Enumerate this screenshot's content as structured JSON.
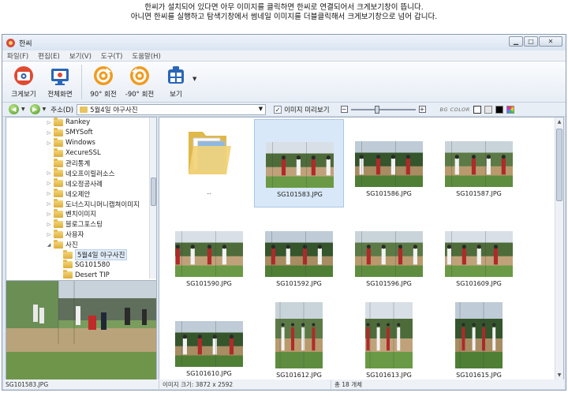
{
  "caption": {
    "line1": "한씨가 설치되어 있다면 아무 이미지를 클릭하면 한씨로 연결되어서 크게보기창이 뜹니다.",
    "line2": "아니면 한씨를 실행하고 탐색기창에서 썸네일 이미지를 더블클릭해서 크게보기창으로 넘어 갑니다."
  },
  "window": {
    "title": "한씨"
  },
  "menu": [
    "파일(F)",
    "편집(E)",
    "보기(V)",
    "도구(T)",
    "도움말(H)"
  ],
  "toolbar": {
    "buttons": [
      {
        "label": "크게보기",
        "icon": "large-view-icon"
      },
      {
        "label": "전체화면",
        "icon": "fullscreen-icon"
      },
      {
        "label": "90° 회전",
        "icon": "rotate-right-icon"
      },
      {
        "label": "-90° 회전",
        "icon": "rotate-left-icon"
      },
      {
        "label": "보기",
        "icon": "view-icon"
      }
    ]
  },
  "address": {
    "label": "주소(D)",
    "value": "5월4일 야구사진",
    "preview_label": "이미지 미리보기",
    "preview_checked": true,
    "bg_label": "BG COLOR",
    "bg_swatches": [
      "#ffffff",
      "#e6e6e6",
      "#000000",
      "multicolor"
    ]
  },
  "tree": {
    "items": [
      {
        "label": "Rankey",
        "indent": 1,
        "expand": "▷"
      },
      {
        "label": "SMYSoft",
        "indent": 1,
        "expand": "▷"
      },
      {
        "label": "Windows",
        "indent": 1,
        "expand": "▷"
      },
      {
        "label": "XecureSSL",
        "indent": 1,
        "expand": ""
      },
      {
        "label": "관리통계",
        "indent": 1,
        "expand": ""
      },
      {
        "label": "네오프이릴러소스",
        "indent": 1,
        "expand": "▷"
      },
      {
        "label": "네오정공사례",
        "indent": 1,
        "expand": "▷"
      },
      {
        "label": "네오제안",
        "indent": 1,
        "expand": "▷"
      },
      {
        "label": "도너스지니머니캡쳐이미지",
        "indent": 1,
        "expand": "▷"
      },
      {
        "label": "벤치이미지",
        "indent": 1,
        "expand": "▷"
      },
      {
        "label": "블로그포스팅",
        "indent": 1,
        "expand": "▷"
      },
      {
        "label": "사용자",
        "indent": 1,
        "expand": "▷"
      },
      {
        "label": "사진",
        "indent": 1,
        "expand": "◢"
      },
      {
        "label": "5월4일 야구사진",
        "indent": 2,
        "expand": "",
        "selected": true
      },
      {
        "label": "SG101580",
        "indent": 2,
        "expand": ""
      },
      {
        "label": "Desert TIP",
        "indent": 2,
        "expand": ""
      }
    ]
  },
  "files": [
    {
      "name": "..",
      "type": "folder"
    },
    {
      "name": "SG101583.JPG",
      "selected": true
    },
    {
      "name": "SG101586.JPG"
    },
    {
      "name": "SG101587.JPG"
    },
    {
      "name": "SG101590.JPG"
    },
    {
      "name": "SG101592.JPG"
    },
    {
      "name": "SG101596.JPG"
    },
    {
      "name": "SG101609.JPG"
    },
    {
      "name": "SG101610.JPG"
    },
    {
      "name": "SG101612.JPG"
    },
    {
      "name": "SG101613.JPG"
    },
    {
      "name": "SG101615.JPG"
    }
  ],
  "status": {
    "filename": "SG101583.JPG",
    "size_text": "이미지 크기: 3872 x 2592",
    "count_text": "총 18 개체"
  }
}
